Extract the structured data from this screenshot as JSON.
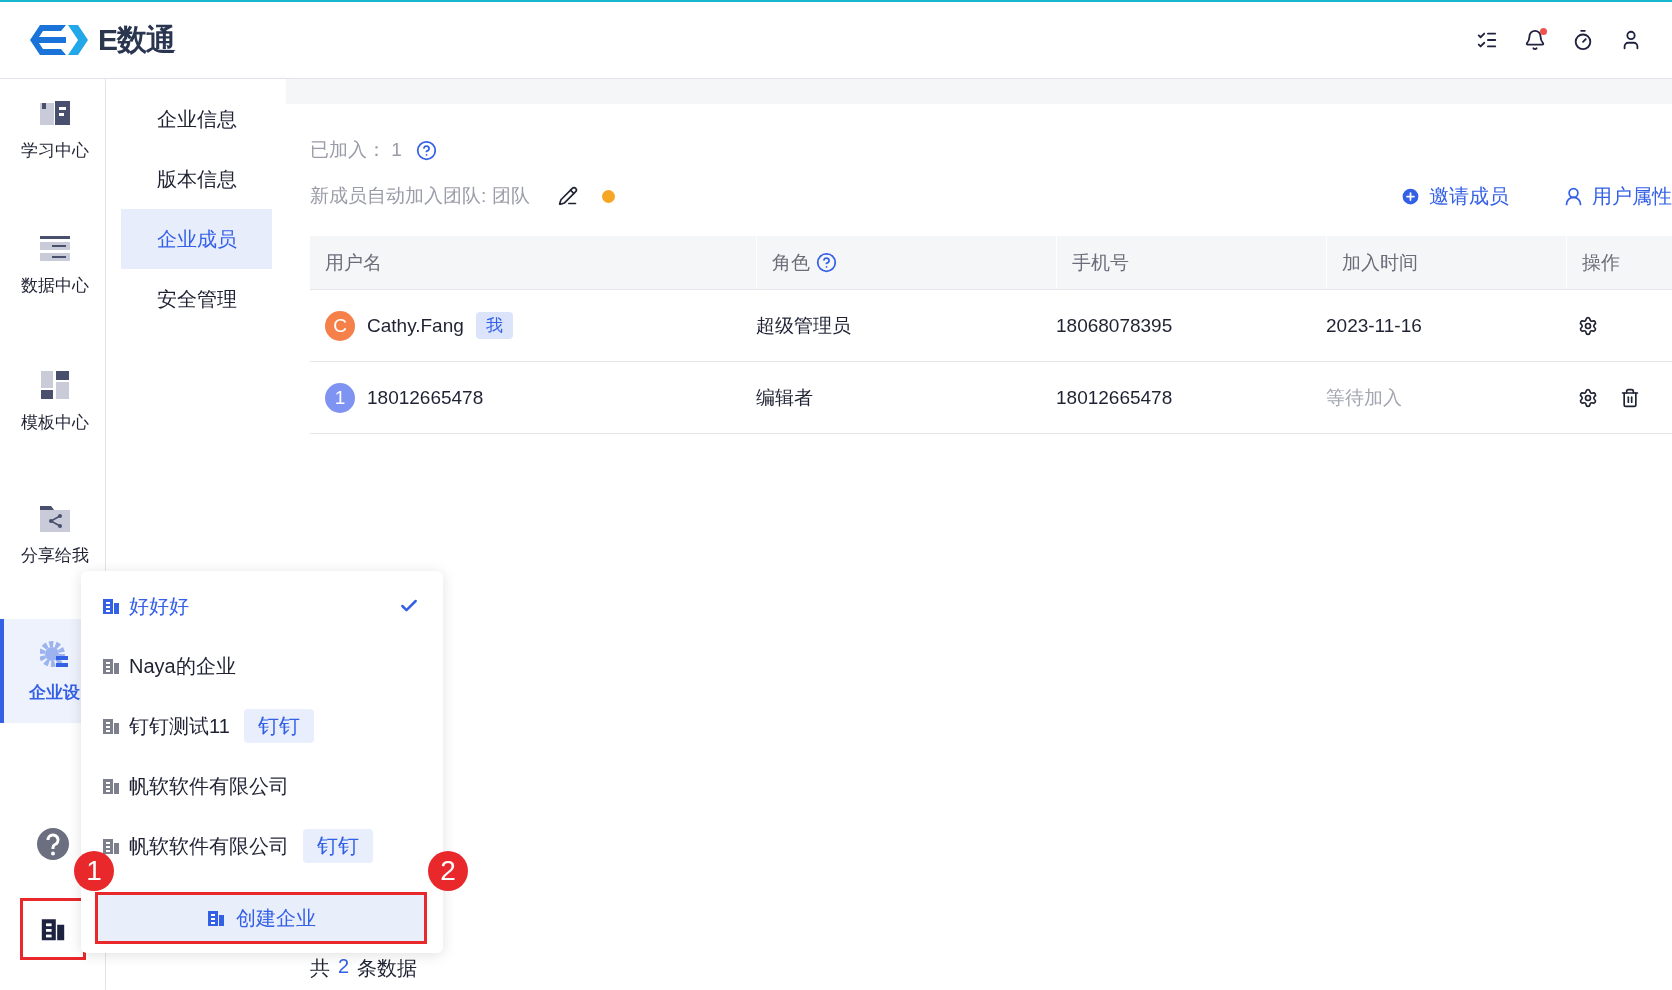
{
  "header": {
    "logo_text": "E数通"
  },
  "rail": {
    "items": [
      {
        "label": "学习中心",
        "selected": false
      },
      {
        "label": "数据中心",
        "selected": false
      },
      {
        "label": "模板中心",
        "selected": false
      },
      {
        "label": "分享给我",
        "selected": false
      },
      {
        "label": "企业设",
        "selected": true
      }
    ],
    "org_button": {
      "highlighted": true
    }
  },
  "submenu": {
    "items": [
      {
        "label": "企业信息",
        "selected": false
      },
      {
        "label": "版本信息",
        "selected": false
      },
      {
        "label": "企业成员",
        "selected": true
      },
      {
        "label": "安全管理",
        "selected": false
      }
    ]
  },
  "summary": {
    "joined_label": "已加入：",
    "joined_count": "1",
    "auto_join": "新成员自动加入团队: 团队"
  },
  "actions": [
    "邀请成员",
    "用户属性"
  ],
  "table": {
    "columns": [
      "用户名",
      "角色",
      "手机号",
      "加入时间",
      "操作"
    ],
    "rows": [
      {
        "avatar": "C",
        "color": "#f5804a",
        "name": "Cathy.Fang",
        "tag": "我",
        "role": "超级管理员",
        "phone": "18068078395",
        "joined": "2023-11-16",
        "pending": false,
        "deletable": false
      },
      {
        "avatar": "1",
        "color": "#7f93f2",
        "name": "18012665478",
        "role": "编辑者",
        "phone": "18012665478",
        "joined": "等待加入",
        "pending": true,
        "deletable": true
      }
    ]
  },
  "footer": {
    "prefix": "共",
    "count": "2",
    "suffix": "条数据"
  },
  "org_menu": {
    "items": [
      {
        "label": "好好好",
        "selected": true
      },
      {
        "label": "Naya的企业",
        "selected": false
      },
      {
        "label": "钉钉测试11",
        "tag": "钉钉",
        "selected": false
      },
      {
        "label": "帆软软件有限公司",
        "selected": false
      },
      {
        "label": "帆软软件有限公司",
        "tag": "钉钉",
        "selected": false
      }
    ],
    "create_button": {
      "label": "创建企业",
      "highlighted": true
    }
  },
  "annotations": [
    "1",
    "2"
  ]
}
